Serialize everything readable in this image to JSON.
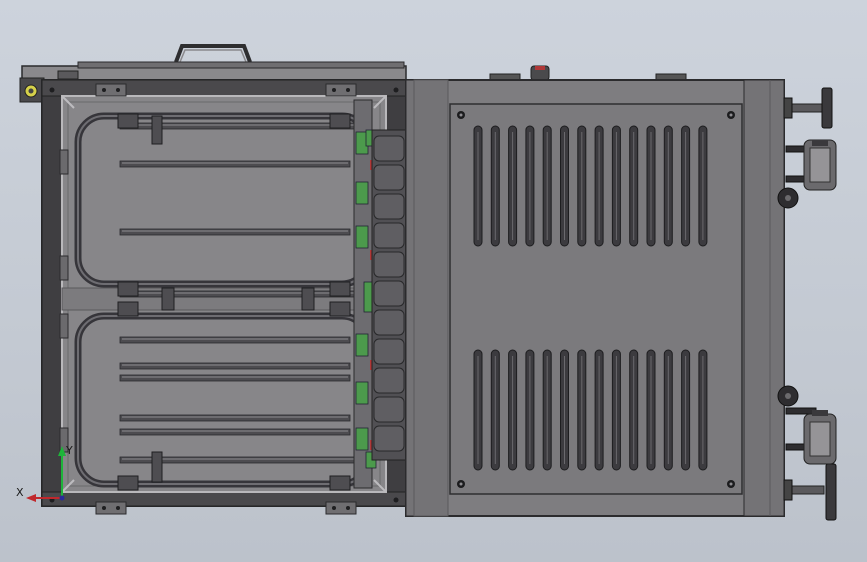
{
  "viewport": {
    "background_top": "#cdd3dc",
    "background_bottom": "#bcc2cb"
  },
  "colors": {
    "frame_dark": "#3e3d3f",
    "frame_mid": "#6e6d70",
    "panel": "#7b7a7d",
    "panel_dark": "#5a595c",
    "rod": "#4d4c50",
    "glass_edge": "#8c8b8f",
    "accent_green": "#4c9a4c",
    "accent_red": "#b03838",
    "axis_x": "#c0282c",
    "axis_y": "#1eb43a"
  },
  "triad": {
    "x_label": "X",
    "y_label": "Y"
  }
}
